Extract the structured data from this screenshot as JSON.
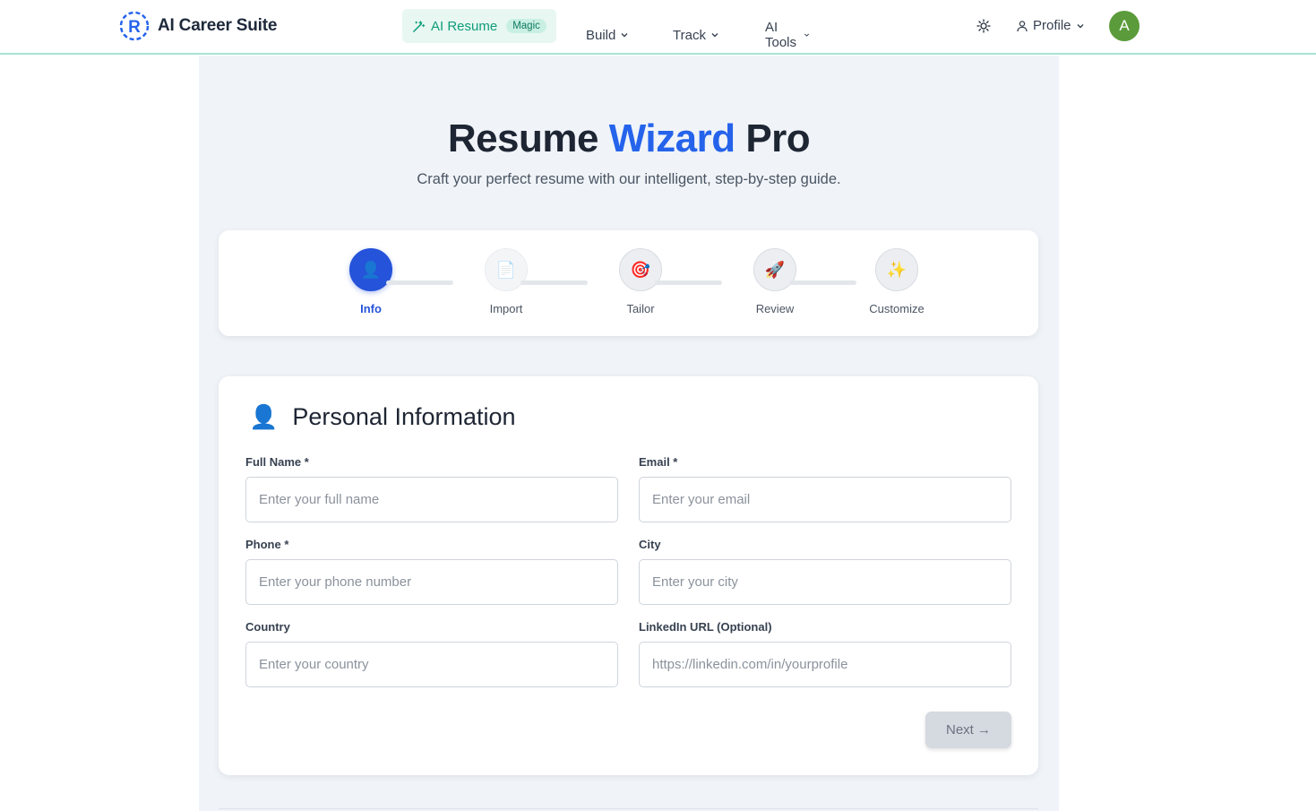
{
  "brand": {
    "name": "AI Career Suite",
    "logo_letter": "R"
  },
  "nav": {
    "magic_label": "AI Resume",
    "magic_badge": "Magic",
    "build": "Build",
    "track": "Track",
    "ai_tools": "AI Tools",
    "profile": "Profile",
    "avatar_initial": "A"
  },
  "hero": {
    "title_part1": "Resume",
    "title_accent": "Wizard",
    "title_part2": "Pro",
    "subtitle": "Craft your perfect resume with our intelligent, step-by-step guide."
  },
  "steps": [
    {
      "label": "Info",
      "icon": "👤",
      "active": true
    },
    {
      "label": "Import",
      "icon": "📄",
      "active": false
    },
    {
      "label": "Tailor",
      "icon": "🎯",
      "active": false
    },
    {
      "label": "Review",
      "icon": "🚀",
      "active": false
    },
    {
      "label": "Customize",
      "icon": "✨",
      "active": false
    }
  ],
  "form": {
    "title": "Personal Information",
    "icon": "👤",
    "fields": {
      "full_name": {
        "label": "Full Name *",
        "placeholder": "Enter your full name"
      },
      "email": {
        "label": "Email *",
        "placeholder": "Enter your email"
      },
      "phone": {
        "label": "Phone *",
        "placeholder": "Enter your phone number"
      },
      "city": {
        "label": "City",
        "placeholder": "Enter your city"
      },
      "country": {
        "label": "Country",
        "placeholder": "Enter your country"
      },
      "linkedin": {
        "label": "LinkedIn URL (Optional)",
        "placeholder": "https://linkedin.com/in/yourprofile"
      }
    },
    "next_label": "Next →"
  },
  "colors": {
    "accent": "#2563eb",
    "magic": "#0f9d7a",
    "avatar": "#5b9b3b"
  }
}
